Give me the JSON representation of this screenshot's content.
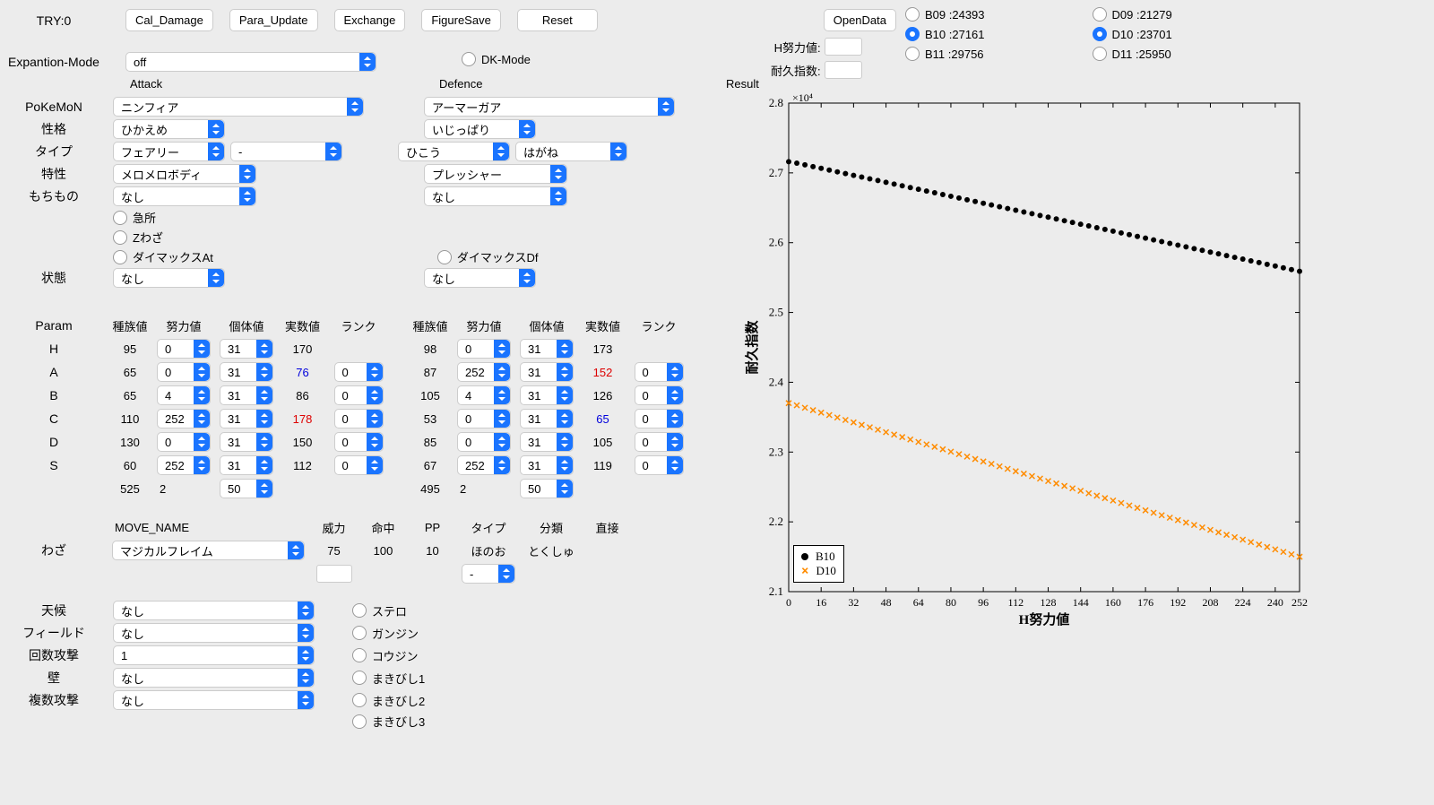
{
  "header": {
    "try_label": "TRY:0",
    "buttons": {
      "cal": "Cal_Damage",
      "para": "Para_Update",
      "exch": "Exchange",
      "fig": "FigureSave",
      "reset": "Reset",
      "open": "OpenData"
    }
  },
  "expantion_label": "Expantion-Mode",
  "expantion_value": "off",
  "dk_mode": "DK-Mode",
  "attack_label": "Attack",
  "defence_label": "Defence",
  "row_labels": {
    "pokemon": "PoKeMoN",
    "nature": "性格",
    "type": "タイプ",
    "ability": "特性",
    "item": "もちもの",
    "status": "状態",
    "param": "Param",
    "move": "わざ",
    "weather": "天候",
    "field": "フィールド",
    "hits": "回数攻撃",
    "wall": "壁",
    "multi": "複数攻撃"
  },
  "attack": {
    "pokemon": "ニンフィア",
    "nature": "ひかえめ",
    "type1": "フェアリー",
    "type2": "-",
    "ability": "メロメロボディ",
    "item": "なし",
    "crit": "急所",
    "zmove": "Zわざ",
    "dmax": "ダイマックスAt",
    "status": "なし"
  },
  "defence": {
    "pokemon": "アーマーガア",
    "nature": "いじっぱり",
    "type1": "ひこう",
    "type2": "はがね",
    "ability": "プレッシャー",
    "item": "なし",
    "dmax": "ダイマックスDf",
    "status": "なし"
  },
  "param_headers": {
    "base": "種族値",
    "ev": "努力値",
    "iv": "個体値",
    "real": "実数値",
    "rank": "ランク"
  },
  "stats_labels": [
    "H",
    "A",
    "B",
    "C",
    "D",
    "S"
  ],
  "atk_stats": [
    {
      "base": "95",
      "ev": "0",
      "iv": "31",
      "real": "170",
      "real_cls": ""
    },
    {
      "base": "65",
      "ev": "0",
      "iv": "31",
      "real": "76",
      "real_cls": "blue",
      "rank": "0"
    },
    {
      "base": "65",
      "ev": "4",
      "iv": "31",
      "real": "86",
      "real_cls": "",
      "rank": "0"
    },
    {
      "base": "110",
      "ev": "252",
      "iv": "31",
      "real": "178",
      "real_cls": "red",
      "rank": "0"
    },
    {
      "base": "130",
      "ev": "0",
      "iv": "31",
      "real": "150",
      "real_cls": "",
      "rank": "0"
    },
    {
      "base": "60",
      "ev": "252",
      "iv": "31",
      "real": "112",
      "real_cls": "",
      "rank": "0"
    }
  ],
  "atk_sum_base": "525",
  "atk_sum_ev": "2",
  "atk_level": "50",
  "def_stats": [
    {
      "base": "98",
      "ev": "0",
      "iv": "31",
      "real": "173",
      "real_cls": ""
    },
    {
      "base": "87",
      "ev": "252",
      "iv": "31",
      "real": "152",
      "real_cls": "red",
      "rank": "0"
    },
    {
      "base": "105",
      "ev": "4",
      "iv": "31",
      "real": "126",
      "real_cls": "",
      "rank": "0"
    },
    {
      "base": "53",
      "ev": "0",
      "iv": "31",
      "real": "65",
      "real_cls": "blue",
      "rank": "0"
    },
    {
      "base": "85",
      "ev": "0",
      "iv": "31",
      "real": "105",
      "real_cls": "",
      "rank": "0"
    },
    {
      "base": "67",
      "ev": "252",
      "iv": "31",
      "real": "119",
      "real_cls": "",
      "rank": "0"
    }
  ],
  "def_sum_base": "495",
  "def_sum_ev": "2",
  "def_level": "50",
  "move_headers": {
    "name": "MOVE_NAME",
    "power": "威力",
    "acc": "命中",
    "pp": "PP",
    "type": "タイプ",
    "cat": "分類",
    "contact": "直接"
  },
  "move": {
    "name": "マジカルフレイム",
    "power": "75",
    "acc": "100",
    "pp": "10",
    "type": "ほのお",
    "cat": "とくしゅ",
    "contact": "",
    "extra": "-"
  },
  "env": {
    "weather": "なし",
    "field": "なし",
    "hits": "1",
    "wall": "なし",
    "multi": "なし"
  },
  "hazards": {
    "stero": "ステロ",
    "ganjin": "ガンジン",
    "koujin": "コウジン",
    "maki1": "まきびし1",
    "maki2": "まきびし2",
    "maki3": "まきびし3"
  },
  "result_label": "Result",
  "result_inputs": {
    "hev": "H努力値:",
    "idx": "耐久指数:"
  },
  "radios": {
    "b09": "B09 :24393",
    "b10": "B10 :27161",
    "b11": "B11 :29756",
    "d09": "D09 :21279",
    "d10": "D10 :23701",
    "d11": "D11 :25950"
  },
  "chart_data": {
    "type": "scatter",
    "xlabel": "H努力値",
    "ylabel": "耐久指数",
    "xlim": [
      0,
      252
    ],
    "ylim": [
      21000,
      28000
    ],
    "y_exp": "×10⁴",
    "xticks": [
      0,
      16,
      32,
      48,
      64,
      80,
      96,
      112,
      128,
      144,
      160,
      176,
      192,
      208,
      224,
      240,
      252
    ],
    "yticks": [
      2.1,
      2.2,
      2.3,
      2.4,
      2.5,
      2.6,
      2.7,
      2.8
    ],
    "series": [
      {
        "name": "B10",
        "marker": "circle",
        "color": "#000",
        "x": [
          0,
          4,
          8,
          12,
          16,
          20,
          24,
          28,
          32,
          36,
          40,
          44,
          48,
          52,
          56,
          60,
          64,
          68,
          72,
          76,
          80,
          84,
          88,
          92,
          96,
          100,
          104,
          108,
          112,
          116,
          120,
          124,
          128,
          132,
          136,
          140,
          144,
          148,
          152,
          156,
          160,
          164,
          168,
          172,
          176,
          180,
          184,
          188,
          192,
          196,
          200,
          204,
          208,
          212,
          216,
          220,
          224,
          228,
          232,
          236,
          240,
          244,
          248,
          252
        ],
        "y": [
          27161,
          27140,
          27115,
          27090,
          27065,
          27040,
          27015,
          26990,
          26965,
          26940,
          26915,
          26890,
          26865,
          26840,
          26815,
          26790,
          26765,
          26740,
          26715,
          26690,
          26665,
          26640,
          26615,
          26590,
          26565,
          26540,
          26515,
          26490,
          26465,
          26440,
          26415,
          26390,
          26365,
          26340,
          26315,
          26290,
          26265,
          26240,
          26215,
          26190,
          26165,
          26140,
          26115,
          26090,
          26065,
          26040,
          26015,
          25990,
          25965,
          25940,
          25915,
          25890,
          25865,
          25840,
          25815,
          25790,
          25765,
          25740,
          25715,
          25690,
          25665,
          25640,
          25615,
          25590
        ]
      },
      {
        "name": "D10",
        "marker": "x",
        "color": "#ff8c00",
        "x": [
          0,
          4,
          8,
          12,
          16,
          20,
          24,
          28,
          32,
          36,
          40,
          44,
          48,
          52,
          56,
          60,
          64,
          68,
          72,
          76,
          80,
          84,
          88,
          92,
          96,
          100,
          104,
          108,
          112,
          116,
          120,
          124,
          128,
          132,
          136,
          140,
          144,
          148,
          152,
          156,
          160,
          164,
          168,
          172,
          176,
          180,
          184,
          188,
          192,
          196,
          200,
          204,
          208,
          212,
          216,
          220,
          224,
          228,
          232,
          236,
          240,
          244,
          248,
          252
        ],
        "y": [
          23701,
          23670,
          23635,
          23600,
          23565,
          23530,
          23495,
          23460,
          23425,
          23390,
          23355,
          23320,
          23285,
          23250,
          23215,
          23180,
          23145,
          23110,
          23075,
          23040,
          23005,
          22970,
          22935,
          22900,
          22865,
          22830,
          22795,
          22760,
          22725,
          22690,
          22655,
          22620,
          22585,
          22550,
          22515,
          22480,
          22445,
          22410,
          22375,
          22340,
          22305,
          22270,
          22235,
          22200,
          22165,
          22130,
          22095,
          22060,
          22025,
          21990,
          21955,
          21920,
          21885,
          21850,
          21815,
          21780,
          21745,
          21710,
          21675,
          21640,
          21605,
          21570,
          21535,
          21500
        ]
      }
    ]
  }
}
